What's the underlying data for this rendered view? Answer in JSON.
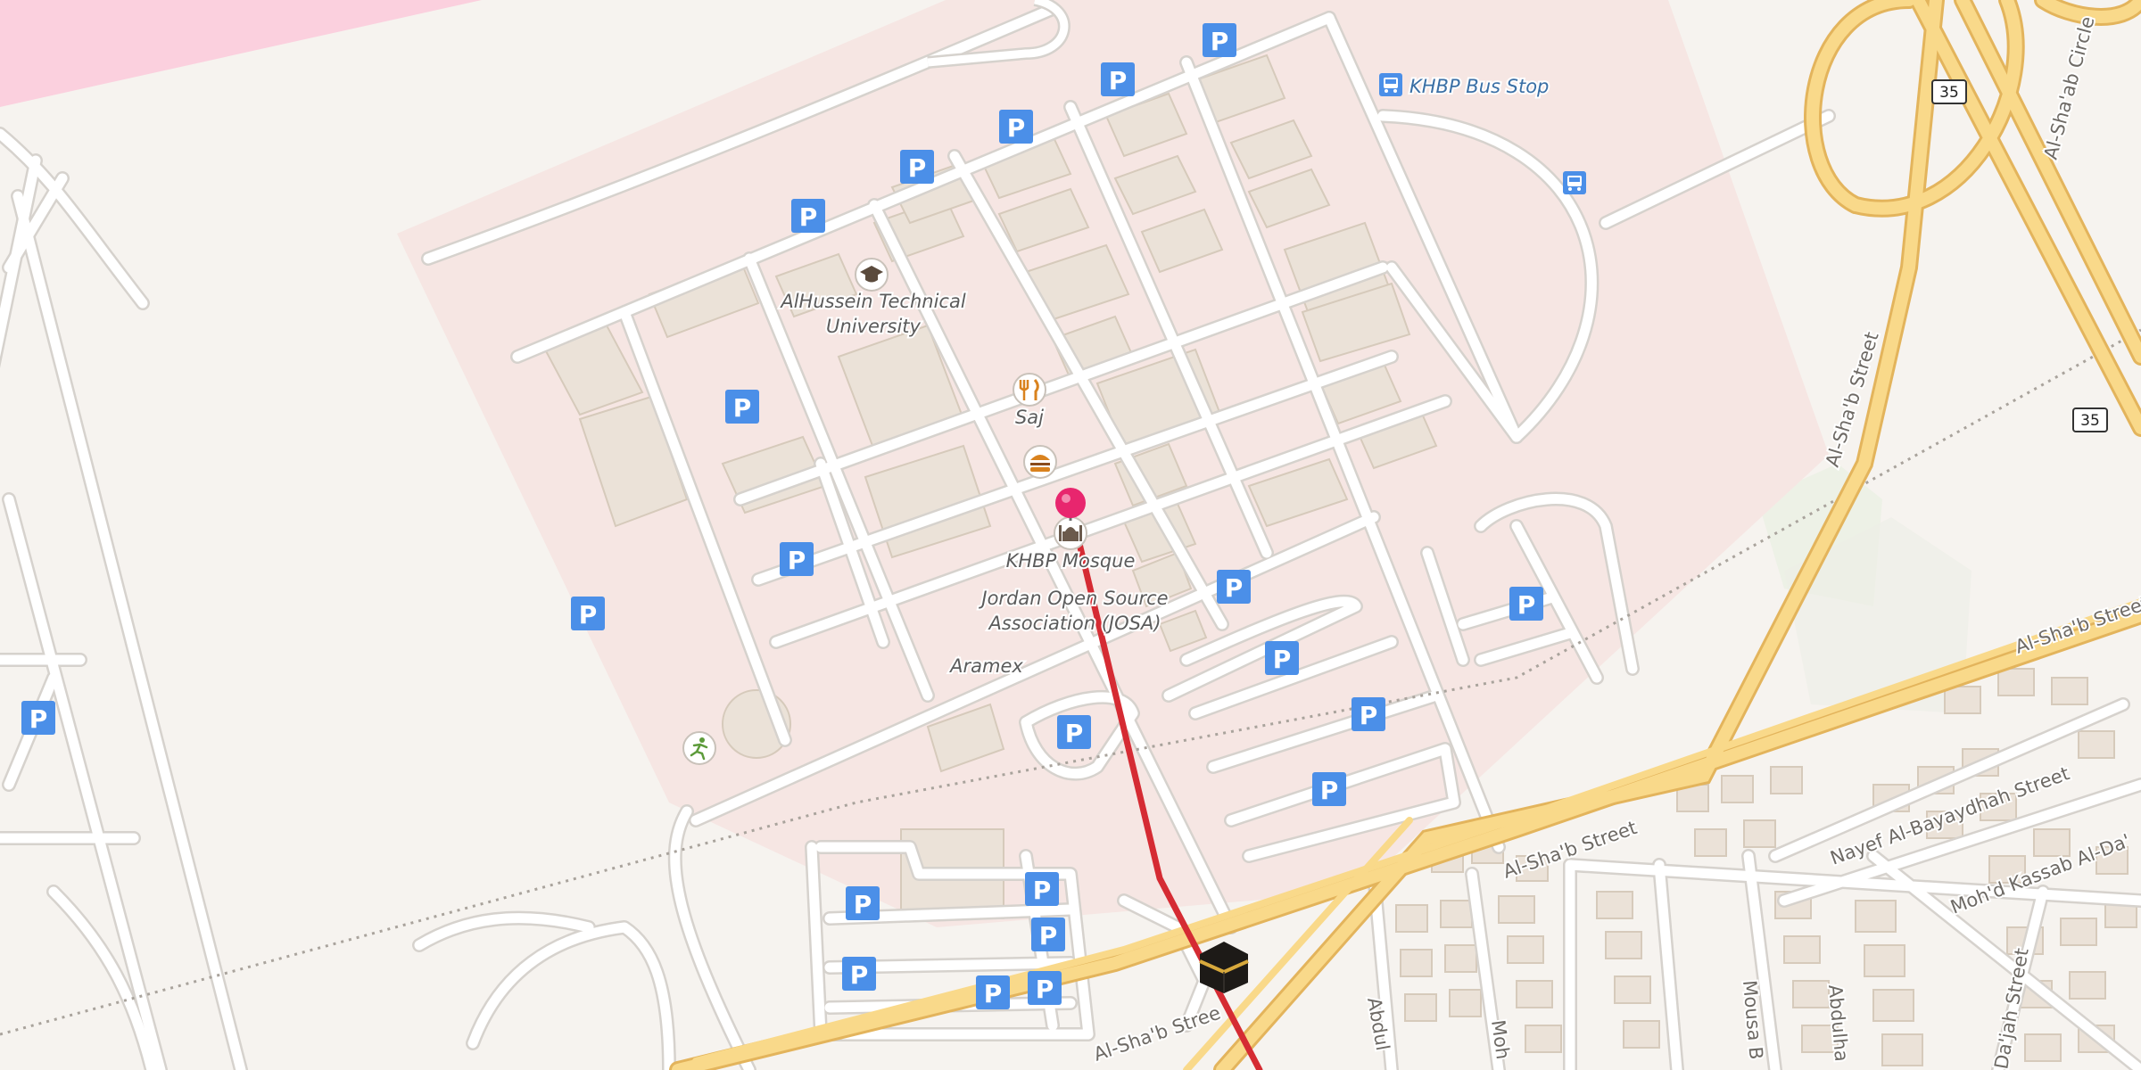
{
  "map": {
    "colors": {
      "background": "#f6f3ef",
      "campus": "#f6e6e3",
      "pink_area": "#fbd0de",
      "road": "#ffffff",
      "road_casing": "#d6d2cd",
      "major_road": "#f9d98a",
      "major_road_casing": "#e3b45c",
      "building": "#ebe2d8",
      "building_edge": "#d3c7b8",
      "parking": "#4b8fe8",
      "route": "#d52b33",
      "pin": "#e8266e",
      "poi_label": "#5b5b5b",
      "street_label": "#6e6a65",
      "bus_label": "#3a6fa5"
    },
    "poi_labels": {
      "university": "AlHussein Technical University",
      "saj": "Saj",
      "mosque": "KHBP Mosque",
      "josa": "Jordan Open Source Association (JOSA)",
      "aramex": "Aramex",
      "bus_stop": "KHBP Bus Stop"
    },
    "street_labels": {
      "al_shaab_upper_right": "Al-Sha'b Street",
      "al_shaab_middle": "Al-Sha'b Street",
      "al_shaab_lower": "Al-Sha'b Stree",
      "al_shaab_vertical": "Al-Sha'b Street",
      "circle": "Al-Sha'ab Circle",
      "nayef": "Nayef Al-Bayaydhah Street",
      "mohd_kassab": "Moh'd Kassab Al-Da'",
      "daajah": "Da'jah Street",
      "mousa": "Mousa B",
      "abdulh": "Abdulha",
      "abdul_lower": "Abdul",
      "moh_lower": "Moh"
    },
    "shields": {
      "top": "35",
      "right": "35"
    },
    "parking_label": "P",
    "icons": {
      "university": "graduation-cap-icon",
      "restaurant": "fork-knife-icon",
      "fast_food": "burger-icon",
      "mosque": "mosque-icon",
      "sports": "running-person-icon",
      "bus": "bus-icon",
      "destination": "kaaba-icon",
      "pin": "location-pin-icon"
    }
  }
}
